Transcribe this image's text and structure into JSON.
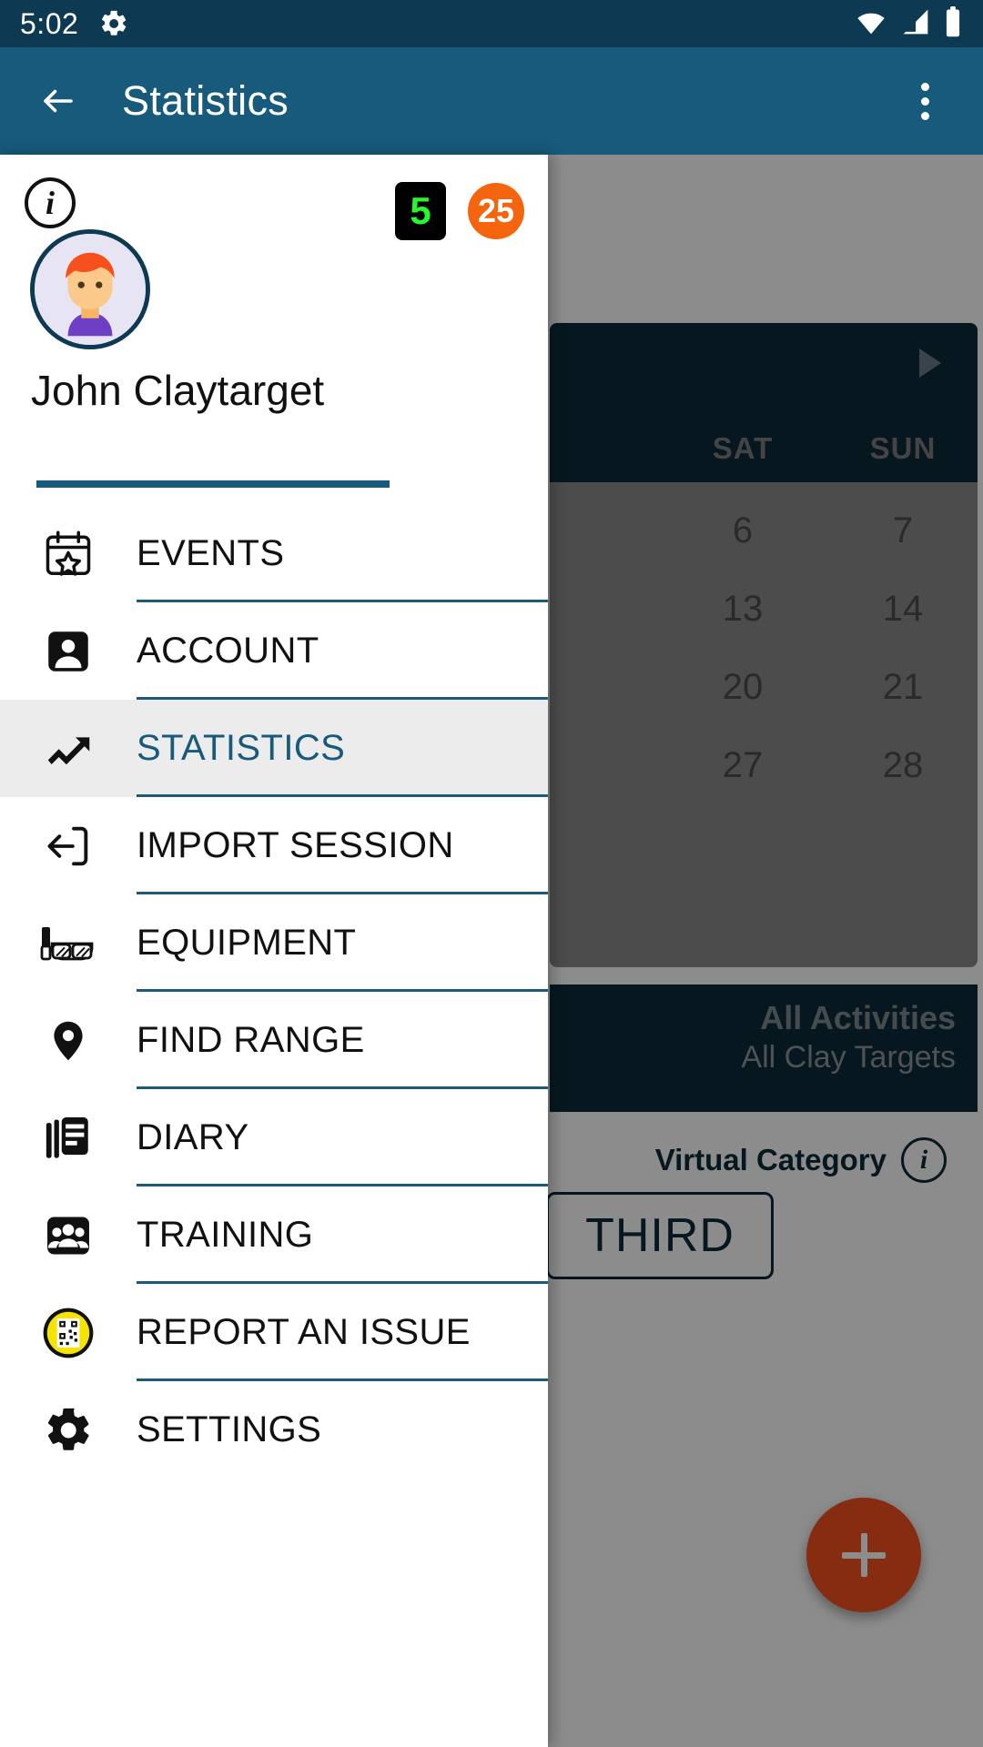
{
  "status_bar": {
    "time": "5:02",
    "icons": [
      "gear-icon",
      "wifi-icon",
      "cellular-signal-icon",
      "battery-icon"
    ]
  },
  "app_bar": {
    "back_label": "←",
    "title": "Statistics",
    "overflow_label": "More options"
  },
  "drawer": {
    "info_label": "i",
    "badges": [
      {
        "name": "score-badge",
        "value": "5",
        "bg": "#000000",
        "fg": "#2bf62b"
      },
      {
        "name": "count-badge",
        "value": "25",
        "bg": "#f4650e",
        "fg": "#ffffff"
      }
    ],
    "user_name": "John Claytarget",
    "items": [
      {
        "label": "EVENTS",
        "icon": "calendar-star-icon",
        "selected": false
      },
      {
        "label": "ACCOUNT",
        "icon": "account-box-icon",
        "selected": false
      },
      {
        "label": "STATISTICS",
        "icon": "trending-up-icon",
        "selected": true
      },
      {
        "label": "IMPORT SESSION",
        "icon": "import-arrow-icon",
        "selected": false
      },
      {
        "label": "EQUIPMENT",
        "icon": "safety-glasses-icon",
        "selected": false
      },
      {
        "label": "FIND RANGE",
        "icon": "map-pin-icon",
        "selected": false
      },
      {
        "label": "DIARY",
        "icon": "library-books-icon",
        "selected": false
      },
      {
        "label": "TRAINING",
        "icon": "people-group-icon",
        "selected": false
      },
      {
        "label": "REPORT AN ISSUE",
        "icon": "qr-code-badge-icon",
        "selected": false
      },
      {
        "label": "SETTINGS",
        "icon": "gear-icon",
        "selected": false
      }
    ]
  },
  "background": {
    "calendar": {
      "next_label": "▶",
      "day_headers": [
        "SAT",
        "SUN"
      ],
      "weeks": [
        [
          "6",
          "7"
        ],
        [
          "13",
          "14"
        ],
        [
          "20",
          "21"
        ],
        [
          "27",
          "28"
        ]
      ]
    },
    "activities_card": {
      "title": "All Activities",
      "subtitle": "All Clay Targets"
    },
    "virtual_category": {
      "label": "Virtual Category",
      "info_label": "i",
      "value": "THIRD"
    },
    "fab_label": "+"
  },
  "colors": {
    "status_bar": "#0d3a52",
    "app_bar": "#175a7c",
    "accent_teal": "#175a7c",
    "selected_row": "#ececec",
    "fab_orange": "#f4511e",
    "badge_green": "#2bf62b",
    "badge_orange": "#f4650e",
    "dark_card": "#0d2b3a"
  }
}
